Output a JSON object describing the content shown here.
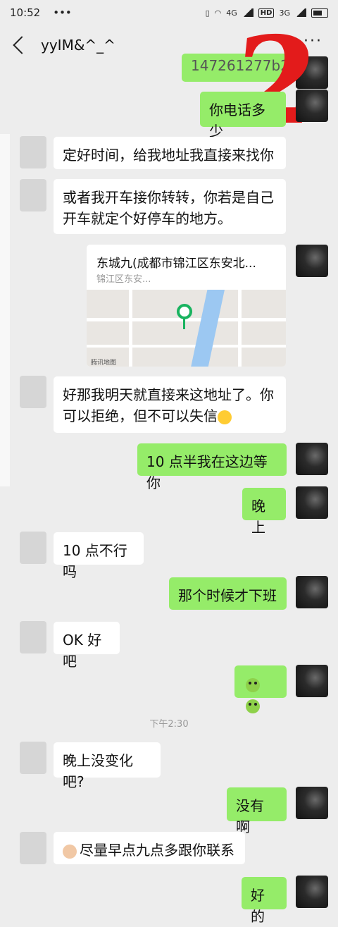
{
  "status": {
    "time": "10:52",
    "dots": "•••",
    "net1": "4G",
    "net2": "HD",
    "net3": "3G"
  },
  "header": {
    "title": "yyIM&^_^",
    "more": "···",
    "badge": "2"
  },
  "messages": {
    "m0": "147261277b2",
    "m1": "你电话多少",
    "m2": "定好时间，给我地址我直接来找你",
    "m3": "或者我开车接你转转，你若是自己开车就定个好停车的地方。",
    "m5": "好那我明天就直接来这地址了。你可以拒绝，但不可以失信",
    "m6": "10 点半我在这边等你",
    "m7": "晚上",
    "m8": "10 点不行吗",
    "m9": "那个时候才下班",
    "m10": "OK 好吧",
    "m12": "晚上没变化吧?",
    "m13": "没有啊",
    "m14": "尽量早点九点多跟你联系",
    "m15": "好的"
  },
  "location": {
    "title": "东城九(成都市锦江区东安北...",
    "subtitle": "锦江区东安...",
    "map_logo": "腾讯地图"
  },
  "timestamp": "下午2:30"
}
